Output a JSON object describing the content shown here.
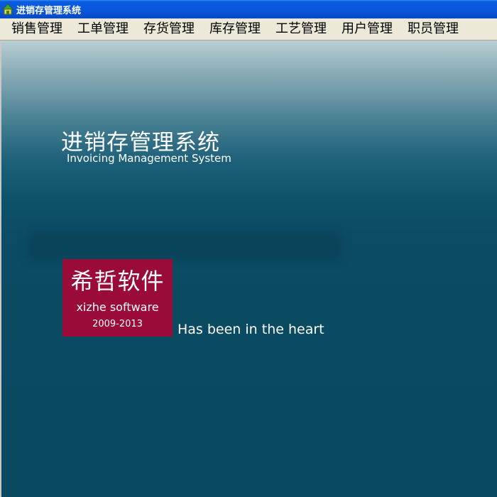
{
  "window": {
    "title": "进销存管理系统"
  },
  "menu": {
    "items": [
      "销售管理",
      "工单管理",
      "存货管理",
      "库存管理",
      "工艺管理",
      "用户管理",
      "职员管理"
    ]
  },
  "splash": {
    "title": "进销存管理系统",
    "subtitle": "Invoicing Management System",
    "logo_cn": "希哲软件",
    "logo_en": "xizhe software",
    "logo_years": "2009-2013",
    "tagline": "Has been in the heart"
  },
  "colors": {
    "titlebar": "#0a55d8",
    "menubar": "#ece9d8",
    "background": "#0a4a60",
    "logo_box": "#9a0b3a"
  }
}
